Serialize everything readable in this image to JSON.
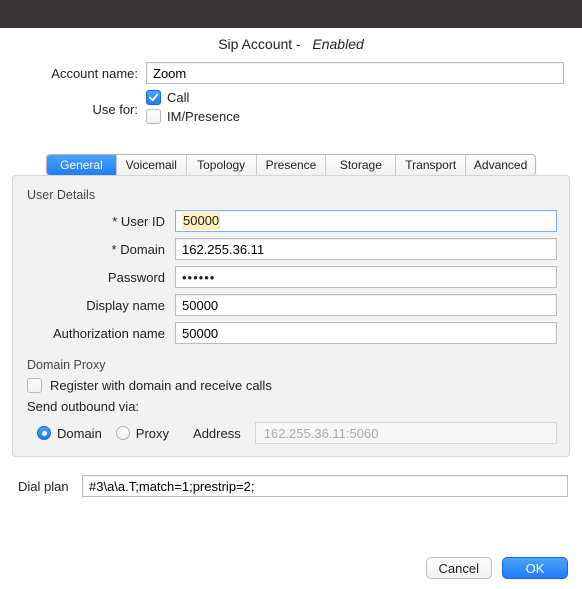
{
  "dialog": {
    "title_prefix": "Sip Account - ",
    "status": "Enabled"
  },
  "account": {
    "name_label": "Account name:",
    "name_value": "Zoom",
    "usefor_label": "Use for:",
    "call_label": "Call",
    "call_checked": true,
    "im_label": "IM/Presence",
    "im_checked": false
  },
  "tabs": [
    "General",
    "Voicemail",
    "Topology",
    "Presence",
    "Storage",
    "Transport",
    "Advanced"
  ],
  "active_tab": "General",
  "user_details": {
    "group_label": "User Details",
    "fields": {
      "user_id": {
        "label": "* User ID",
        "value": "50000",
        "focused": true,
        "selected": true
      },
      "domain": {
        "label": "* Domain",
        "value": "162.255.36.11"
      },
      "password": {
        "label": "Password",
        "value": "••••••"
      },
      "display_name": {
        "label": "Display name",
        "value": "50000"
      },
      "auth_name": {
        "label": "Authorization name",
        "value": "50000"
      }
    }
  },
  "domain_proxy": {
    "group_label": "Domain Proxy",
    "register_label": "Register with domain and receive calls",
    "register_checked": false,
    "send_outbound_label": "Send outbound via:",
    "options": {
      "domain": "Domain",
      "proxy": "Proxy"
    },
    "selected": "domain",
    "address_label": "Address",
    "address_placeholder": "162.255.36.11:5060"
  },
  "dial_plan": {
    "label": "Dial plan",
    "value": "#3\\a\\a.T;match=1;prestrip=2;"
  },
  "buttons": {
    "cancel": "Cancel",
    "ok": "OK"
  }
}
